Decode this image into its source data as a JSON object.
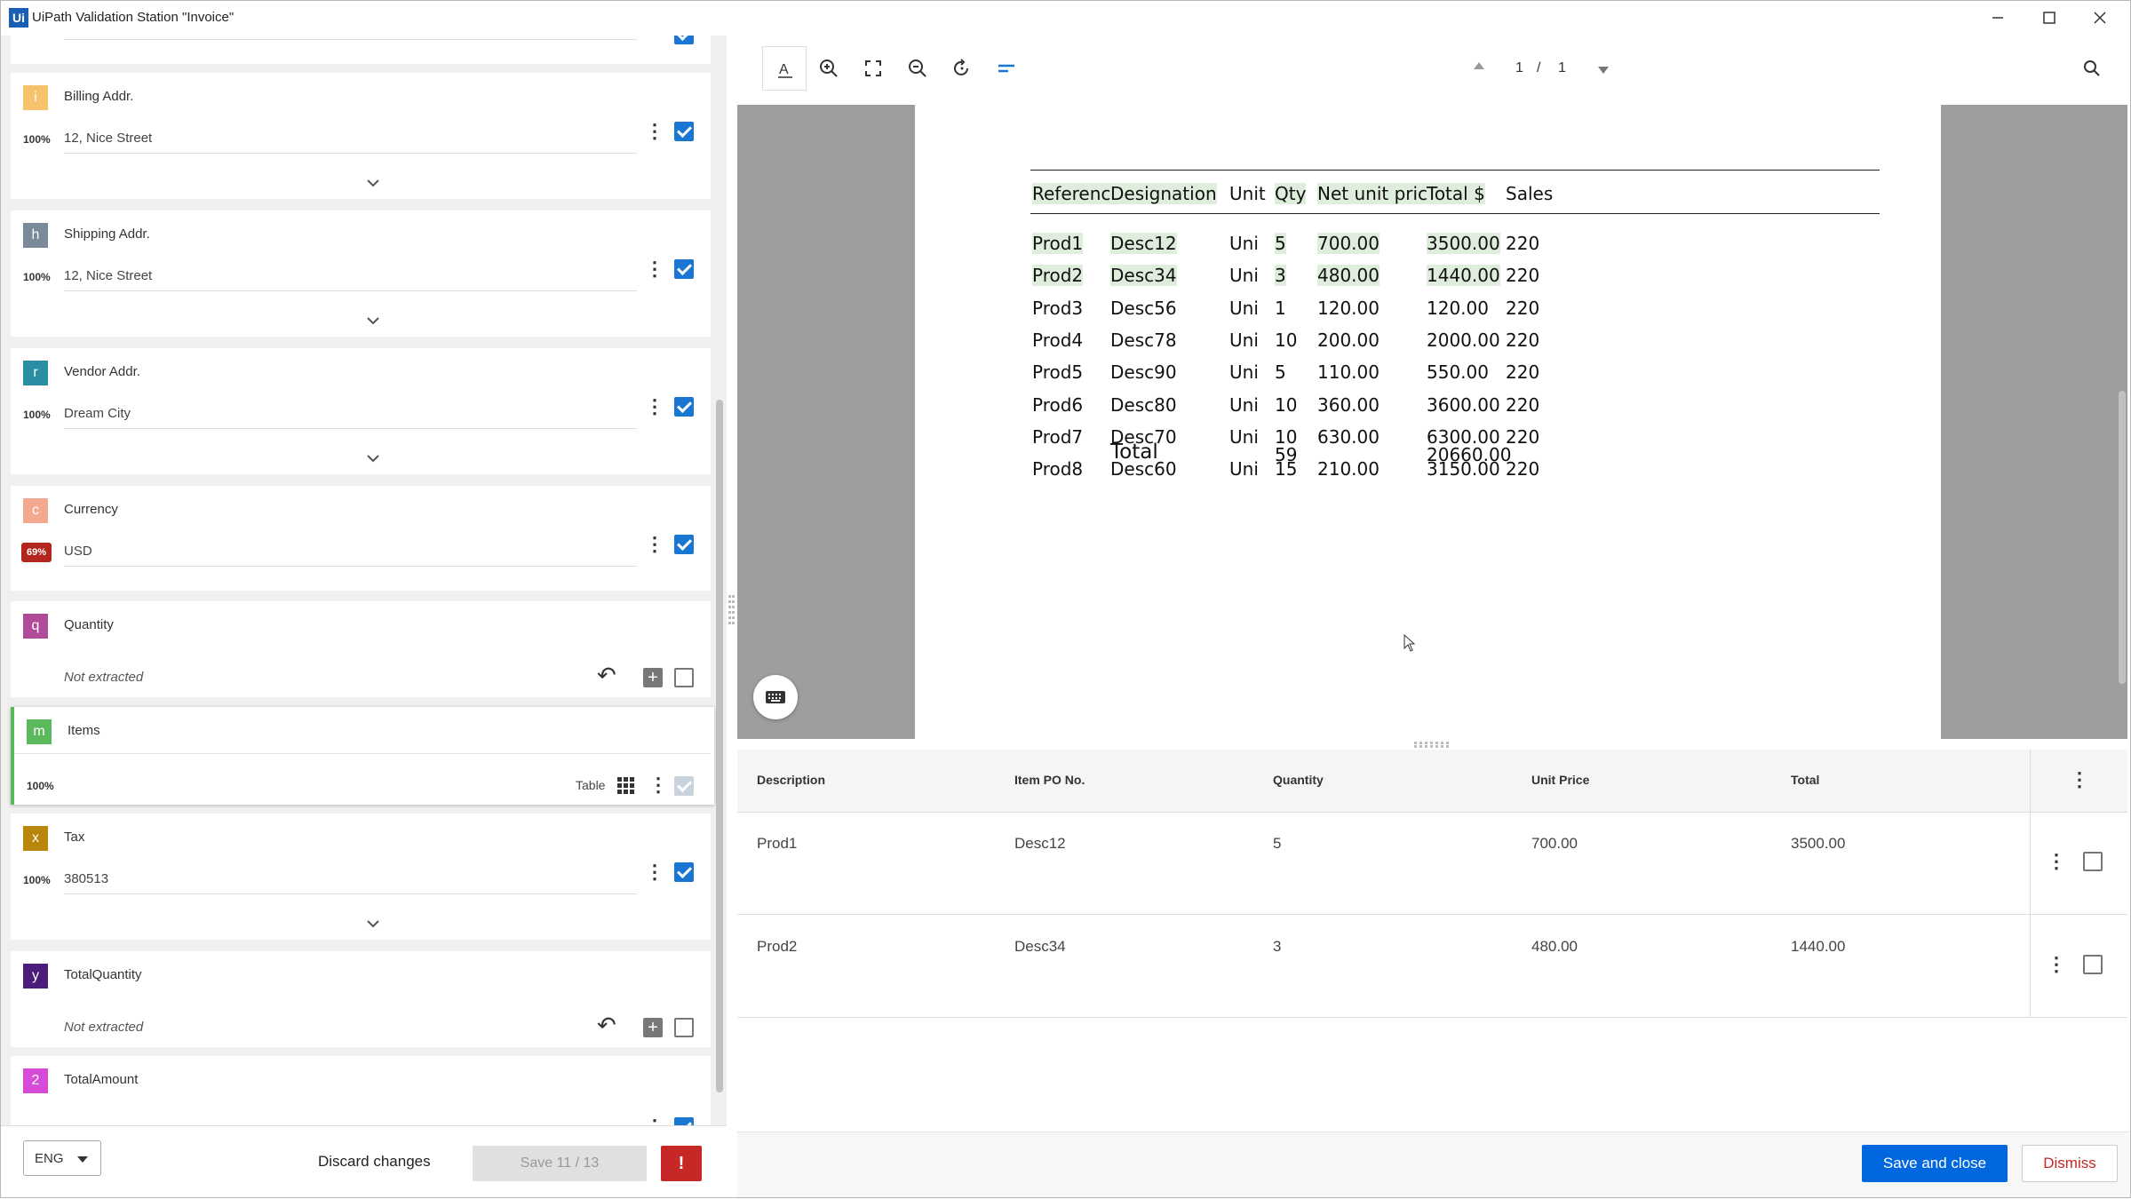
{
  "window": {
    "app_icon": "Ui",
    "title": "UiPath Validation Station \"Invoice\"",
    "controls": [
      "minimize-icon",
      "maximize-icon",
      "close-icon"
    ]
  },
  "fields": [
    {
      "letter": "i",
      "color": "#f6c26b",
      "name": "Billing Addr.",
      "confidence": "100%",
      "value": "12, Nice Street",
      "checked": true
    },
    {
      "letter": "h",
      "color": "#7b8a99",
      "name": "Shipping Addr.",
      "confidence": "100%",
      "value": "12, Nice Street",
      "checked": true
    },
    {
      "letter": "r",
      "color": "#2b8fa3",
      "name": "Vendor Addr.",
      "confidence": "100%",
      "value": "Dream City",
      "checked": true
    },
    {
      "letter": "c",
      "color": "#f4a88f",
      "name": "Currency",
      "confidence": "69%",
      "value": "USD",
      "checked": true
    },
    {
      "letter": "q",
      "color": "#b04b9a",
      "name": "Quantity",
      "value": "Not extracted",
      "checked": false
    },
    {
      "letter": "m",
      "color": "#5cb85c",
      "name": "Items",
      "confidence": "100%",
      "type_label": "Table",
      "checked": true
    },
    {
      "letter": "x",
      "color": "#b8860b",
      "name": "Tax",
      "confidence": "100%",
      "value": "380513",
      "checked": true
    },
    {
      "letter": "y",
      "color": "#4b1c7a",
      "name": "TotalQuantity",
      "value": "Not extracted",
      "checked": false
    },
    {
      "letter": "2",
      "color": "#d84ad8",
      "name": "TotalAmount",
      "checked": true
    }
  ],
  "bottom_left": {
    "language": "ENG",
    "discard": "Discard changes",
    "save": "Save 11 / 13",
    "error": "!"
  },
  "toolbar": {
    "tools": [
      "text-select-icon",
      "zoom-in-icon",
      "fit-screen-icon",
      "zoom-out-icon",
      "rotate-icon",
      "align-icon"
    ],
    "page_current": "1",
    "page_sep": "/",
    "page_total": "1",
    "search_icon": "search-icon"
  },
  "document": {
    "headers": [
      "Reference",
      "Designation",
      "Unit",
      "Qty",
      "Net unit price",
      "Total $",
      "Sales"
    ],
    "rows": [
      [
        "Prod1",
        "Desc12",
        "Uni",
        "5",
        "700.00",
        "3500.00",
        "220"
      ],
      [
        "Prod2",
        "Desc34",
        "Uni",
        "3",
        "480.00",
        "1440.00",
        "220"
      ],
      [
        "Prod3",
        "Desc56",
        "Uni",
        "1",
        "120.00",
        "120.00",
        "220"
      ],
      [
        "Prod4",
        "Desc78",
        "Uni",
        "10",
        "200.00",
        "2000.00",
        "220"
      ],
      [
        "Prod5",
        "Desc90",
        "Uni",
        "5",
        "110.00",
        "550.00",
        "220"
      ],
      [
        "Prod6",
        "Desc80",
        "Uni",
        "10",
        "360.00",
        "3600.00",
        "220"
      ],
      [
        "Prod7",
        "Desc70",
        "Uni",
        "10",
        "630.00",
        "6300.00",
        "220"
      ],
      [
        "Prod8",
        "Desc60",
        "Uni",
        "15",
        "210.00",
        "3150.00",
        "220"
      ]
    ],
    "total_label": "Total",
    "total_qty": "59",
    "total_amount": "20660.00"
  },
  "items_table": {
    "columns": [
      "Description",
      "Item PO No.",
      "Quantity",
      "Unit Price",
      "Total"
    ],
    "rows": [
      [
        "Prod1",
        "Desc12",
        "5",
        "700.00",
        "3500.00"
      ],
      [
        "Prod2",
        "Desc34",
        "3",
        "480.00",
        "1440.00"
      ]
    ]
  },
  "bottom_right": {
    "save_close": "Save and close",
    "dismiss": "Dismiss"
  }
}
